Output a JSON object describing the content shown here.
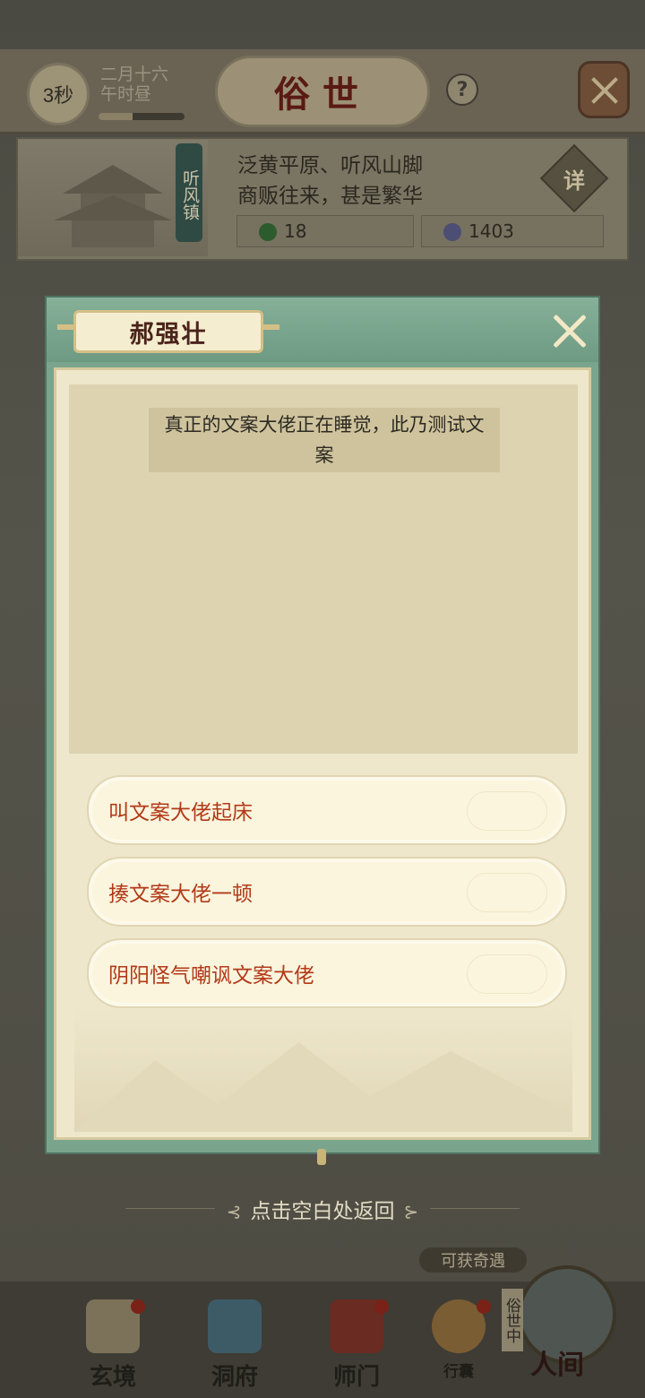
{
  "hud": {
    "timer": "3秒",
    "date_line1": "二月十六",
    "date_line2": "午时昼",
    "day_progress": 0.4,
    "title": "俗世",
    "help_label": "?"
  },
  "town": {
    "name": "听风镇",
    "desc_line1": "泛黄平原、听风山脚",
    "desc_line2": "商贩往来，甚是繁华",
    "detail_label": "详",
    "jade": "18",
    "coins": "1403"
  },
  "dialog": {
    "npc_name": "郝强壮",
    "speech": "真正的文案大佬正在睡觉，此乃测试文案",
    "options": [
      "叫文案大佬起床",
      "揍文案大佬一顿",
      "阴阳怪气嘲讽文案大佬"
    ],
    "dismiss_hint": "点击空白处返回"
  },
  "bottom": {
    "chance_label": "可获奇遇",
    "status_tag": "俗世中",
    "nav": [
      {
        "label": "玄境"
      },
      {
        "label": "洞府"
      },
      {
        "label": "师门"
      },
      {
        "label": "行囊"
      },
      {
        "label": "人间"
      }
    ]
  },
  "colors": {
    "modal_frame": "#7aa48c",
    "paper": "#efe7cc",
    "option_text": "#b23a18",
    "name_text": "#4a231a"
  }
}
